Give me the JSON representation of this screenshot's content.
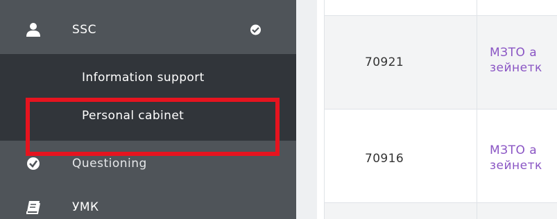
{
  "sidebar": {
    "items": [
      {
        "label": "SSC",
        "icon": "user-icon",
        "badge_icon": "check-circle-icon"
      },
      {
        "label": "Questioning",
        "icon": "check-circle-icon"
      },
      {
        "label": "УМК",
        "icon": "book-icon"
      }
    ],
    "submenu": [
      {
        "label": "Information support"
      },
      {
        "label": "Personal cabinet"
      }
    ]
  },
  "table": {
    "rows": [
      {
        "id": "70921",
        "name_line1": "МЗТО а",
        "name_line2": "зейнетк"
      },
      {
        "id": "70916",
        "name_line1": "МЗТО а",
        "name_line2": "зейнетк"
      }
    ]
  },
  "colors": {
    "sidebar_bg": "#4f5459",
    "submenu_bg": "#31353a",
    "highlight": "#e6141f",
    "link": "#8a55c4"
  }
}
